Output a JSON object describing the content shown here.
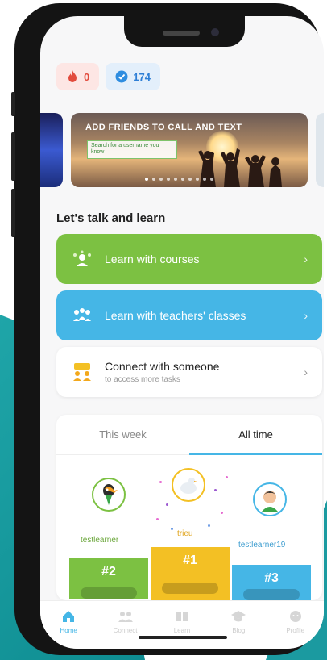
{
  "stats": {
    "streak": "0",
    "gems": "174"
  },
  "banner": {
    "title": "ADD FRIENDS TO CALL AND TEXT",
    "tag": "Search for a username you know"
  },
  "section_title": "Let's talk and learn",
  "actions": {
    "courses": "Learn with courses",
    "teachers": "Learn with teachers' classes",
    "connect_title": "Connect with someone",
    "connect_sub": "to access more tasks"
  },
  "leaderboard": {
    "tabs": [
      "This week",
      "All time"
    ],
    "active_tab": "All time",
    "entries": [
      {
        "rank": "#2",
        "name": "testlearner"
      },
      {
        "rank": "#1",
        "name": "trieu"
      },
      {
        "rank": "#3",
        "name": "testlearner19"
      }
    ]
  },
  "tabbar": {
    "items": [
      "Home",
      "Connect",
      "Learn",
      "Blog",
      "Profile"
    ],
    "active": "Home"
  },
  "colors": {
    "green": "#7cc142",
    "blue": "#45b6e6",
    "gold": "#f3c024",
    "teal_bg": "#1fa5a8"
  },
  "carousel": {
    "dot_count": 10,
    "active_dot": 0
  }
}
